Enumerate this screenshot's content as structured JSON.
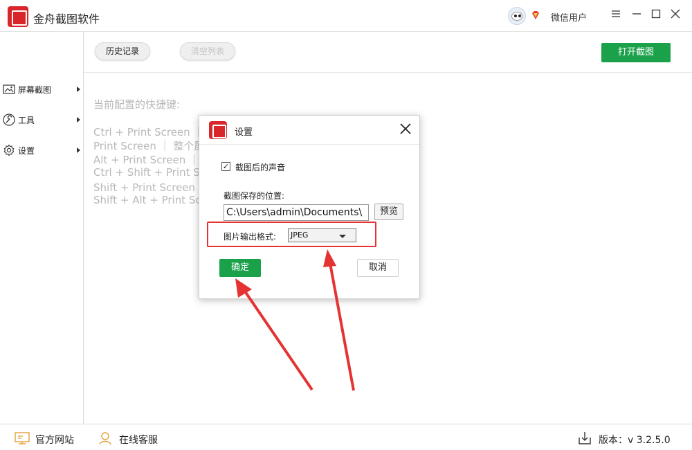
{
  "app": {
    "title": "金舟截图软件",
    "username": "微信用户",
    "window_controls": [
      "menu-icon",
      "minimize-icon",
      "maximize-icon",
      "close-icon"
    ]
  },
  "sidebar": {
    "items": [
      {
        "label": "屏幕截图",
        "icon": "image-icon"
      },
      {
        "label": "工具",
        "icon": "wrench-icon"
      },
      {
        "label": "设置",
        "icon": "gear-icon"
      }
    ]
  },
  "toolbar": {
    "history_label": "历史记录",
    "clear_label": "清空列表",
    "open_screenshot_label": "打开截图"
  },
  "hotkeys": {
    "title": "当前配置的快捷键:",
    "lines": [
      "Ctrl + Print Screen ｜ 矩",
      "Print Screen ｜ 整个屏",
      "Alt + Print Screen ｜ 滚",
      "Ctrl + Shift + Print Scre",
      "Shift + Print Screen ｜",
      "Shift + Alt + Print Scre"
    ]
  },
  "dialog": {
    "title": "设置",
    "sound_checkbox_label": "截图后的声音",
    "sound_checked": true,
    "save_location_label": "截图保存的位置:",
    "save_path_value": "C:\\Users\\admin\\Documents\\",
    "preview_label": "预览",
    "output_format_label": "图片输出格式:",
    "output_format_value": "JPEG",
    "ok_label": "确定",
    "cancel_label": "取消"
  },
  "statusbar": {
    "website_label": "官方网站",
    "support_label": "在线客服",
    "version_label": "版本：v 3.2.5.0"
  },
  "colors": {
    "brand_red": "#d8262b",
    "accent_green": "#1aa14a",
    "annotation_red": "#e53333"
  }
}
